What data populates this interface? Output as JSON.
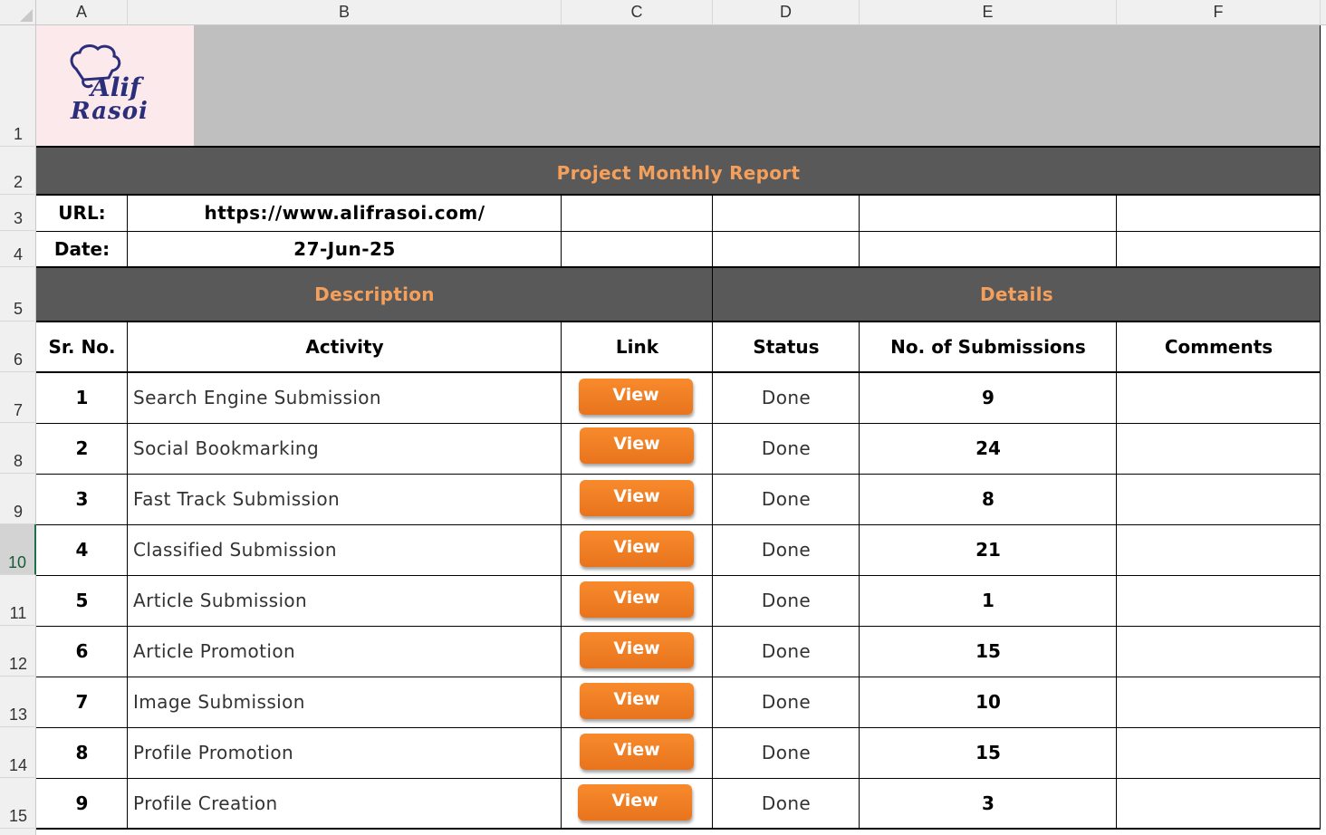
{
  "columns": [
    "A",
    "B",
    "C",
    "D",
    "E",
    "F"
  ],
  "row_numbers": [
    "1",
    "2",
    "3",
    "4",
    "5",
    "6",
    "7",
    "8",
    "9",
    "10",
    "11",
    "12",
    "13",
    "14",
    "15"
  ],
  "logo": {
    "line1": "Alif",
    "line2": "Rasoi"
  },
  "title": "Project Monthly Report",
  "url": {
    "label": "URL:",
    "value": "https://www.alifrasoi.com/"
  },
  "date": {
    "label": "Date:",
    "value": "27-Jun-25"
  },
  "sections": {
    "description": "Description",
    "details": "Details"
  },
  "headers": {
    "sr": "Sr. No.",
    "activity": "Activity",
    "link": "Link",
    "status": "Status",
    "submissions": "No. of Submissions",
    "comments": "Comments"
  },
  "rows": [
    {
      "sr": "1",
      "activity": "Search Engine Submission",
      "link": "View",
      "status": "Done",
      "submissions": "9"
    },
    {
      "sr": "2",
      "activity": "Social Bookmarking",
      "link": "View",
      "status": "Done",
      "submissions": "24"
    },
    {
      "sr": "3",
      "activity": "Fast Track Submission",
      "link": "View",
      "status": "Done",
      "submissions": "8"
    },
    {
      "sr": "4",
      "activity": "Classified Submission",
      "link": "View",
      "status": "Done",
      "submissions": "21"
    },
    {
      "sr": "5",
      "activity": "Article Submission",
      "link": "View",
      "status": "Done",
      "submissions": "1"
    },
    {
      "sr": "6",
      "activity": "Article Promotion",
      "link": "View",
      "status": "Done",
      "submissions": "15"
    },
    {
      "sr": "7",
      "activity": "Image Submission",
      "link": "View",
      "status": "Done",
      "submissions": "10"
    },
    {
      "sr": "8",
      "activity": "Profile Promotion",
      "link": "View",
      "status": "Done",
      "submissions": "15"
    },
    {
      "sr": "9",
      "activity": "Profile Creation",
      "link": "View",
      "status": "Done",
      "submissions": "3"
    }
  ],
  "colors": {
    "header_bar": "#595959",
    "header_text": "#f4a05c",
    "button": "#f47f24",
    "logo_text": "#2b2e7a",
    "selection": "#1e7145"
  }
}
